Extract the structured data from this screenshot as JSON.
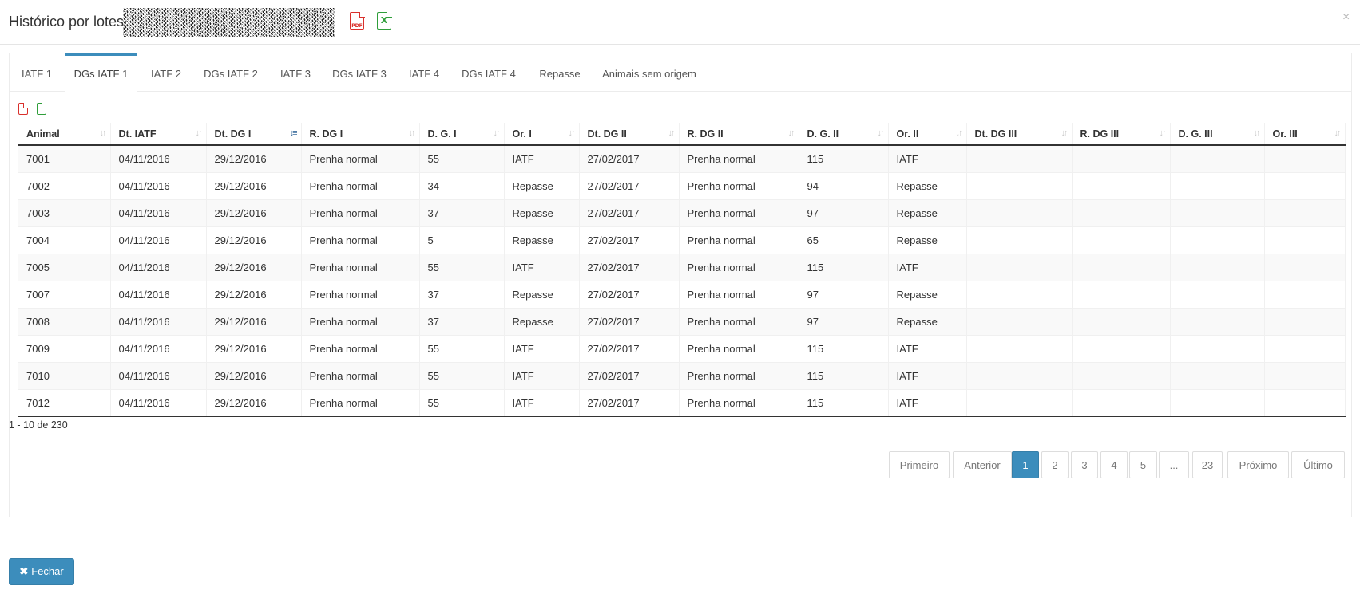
{
  "modal": {
    "title": "Histórico por lotes",
    "close_glyph": "×"
  },
  "export": {
    "pdf_label": "PDF",
    "excel_label": "X"
  },
  "tabs": [
    {
      "label": "IATF 1",
      "active": false
    },
    {
      "label": "DGs IATF 1",
      "active": true
    },
    {
      "label": "IATF 2",
      "active": false
    },
    {
      "label": "DGs IATF 2",
      "active": false
    },
    {
      "label": "IATF 3",
      "active": false
    },
    {
      "label": "DGs IATF 3",
      "active": false
    },
    {
      "label": "IATF 4",
      "active": false
    },
    {
      "label": "DGs IATF 4",
      "active": false
    },
    {
      "label": "Repasse",
      "active": false
    },
    {
      "label": "Animais sem origem",
      "active": false
    }
  ],
  "table": {
    "columns": [
      "Animal",
      "Dt. IATF",
      "Dt. DG I",
      "R. DG I",
      "D. G. I",
      "Or. I",
      "Dt. DG II",
      "R. DG II",
      "D. G. II",
      "Or. II",
      "Dt. DG III",
      "R. DG III",
      "D. G. III",
      "Or. III"
    ],
    "sorted_column": "Dt. DG I",
    "rows": [
      [
        "7001",
        "04/11/2016",
        "29/12/2016",
        "Prenha normal",
        "55",
        "IATF",
        "27/02/2017",
        "Prenha normal",
        "115",
        "IATF",
        "",
        "",
        "",
        ""
      ],
      [
        "7002",
        "04/11/2016",
        "29/12/2016",
        "Prenha normal",
        "34",
        "Repasse",
        "27/02/2017",
        "Prenha normal",
        "94",
        "Repasse",
        "",
        "",
        "",
        ""
      ],
      [
        "7003",
        "04/11/2016",
        "29/12/2016",
        "Prenha normal",
        "37",
        "Repasse",
        "27/02/2017",
        "Prenha normal",
        "97",
        "Repasse",
        "",
        "",
        "",
        ""
      ],
      [
        "7004",
        "04/11/2016",
        "29/12/2016",
        "Prenha normal",
        "5",
        "Repasse",
        "27/02/2017",
        "Prenha normal",
        "65",
        "Repasse",
        "",
        "",
        "",
        ""
      ],
      [
        "7005",
        "04/11/2016",
        "29/12/2016",
        "Prenha normal",
        "55",
        "IATF",
        "27/02/2017",
        "Prenha normal",
        "115",
        "IATF",
        "",
        "",
        "",
        ""
      ],
      [
        "7007",
        "04/11/2016",
        "29/12/2016",
        "Prenha normal",
        "37",
        "Repasse",
        "27/02/2017",
        "Prenha normal",
        "97",
        "Repasse",
        "",
        "",
        "",
        ""
      ],
      [
        "7008",
        "04/11/2016",
        "29/12/2016",
        "Prenha normal",
        "37",
        "Repasse",
        "27/02/2017",
        "Prenha normal",
        "97",
        "Repasse",
        "",
        "",
        "",
        ""
      ],
      [
        "7009",
        "04/11/2016",
        "29/12/2016",
        "Prenha normal",
        "55",
        "IATF",
        "27/02/2017",
        "Prenha normal",
        "115",
        "IATF",
        "",
        "",
        "",
        ""
      ],
      [
        "7010",
        "04/11/2016",
        "29/12/2016",
        "Prenha normal",
        "55",
        "IATF",
        "27/02/2017",
        "Prenha normal",
        "115",
        "IATF",
        "",
        "",
        "",
        ""
      ],
      [
        "7012",
        "04/11/2016",
        "29/12/2016",
        "Prenha normal",
        "55",
        "IATF",
        "27/02/2017",
        "Prenha normal",
        "115",
        "IATF",
        "",
        "",
        "",
        ""
      ]
    ]
  },
  "summary": "1 - 10 de 230",
  "pagination": {
    "buttons": [
      "Primeiro",
      "Anterior",
      "1",
      "2",
      "3",
      "4",
      "5",
      "...",
      "23",
      "Próximo",
      "Último"
    ],
    "active": "1"
  },
  "footer": {
    "close_glyph": "✖",
    "close_label": "Fechar"
  },
  "colors": {
    "accent": "#3c8dbc",
    "pdf": "#d9302c",
    "excel": "#2f9e3a"
  },
  "icons": [
    "pdf-icon",
    "excel-icon",
    "close-icon",
    "sort-icon"
  ]
}
